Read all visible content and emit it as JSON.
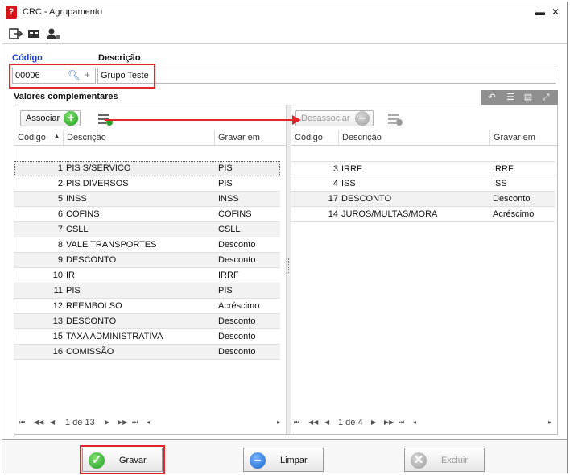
{
  "window": {
    "title": "CRC - Agrupamento",
    "minimize": "▬",
    "close": "✕"
  },
  "form": {
    "codigo_label": "Código",
    "descricao_label": "Descrição",
    "codigo_value": "00006",
    "descricao_value": "Grupo Teste"
  },
  "section": {
    "title": "Valores complementares"
  },
  "left": {
    "associar_label": "Associar",
    "headers": [
      "Código",
      "Descrição",
      "Gravar em"
    ],
    "rows": [
      {
        "codigo": "1",
        "descricao": "PIS S/SERVICO",
        "gravar": "PIS"
      },
      {
        "codigo": "2",
        "descricao": "PIS DIVERSOS",
        "gravar": "PIS"
      },
      {
        "codigo": "5",
        "descricao": "INSS",
        "gravar": "INSS"
      },
      {
        "codigo": "6",
        "descricao": "COFINS",
        "gravar": "COFINS"
      },
      {
        "codigo": "7",
        "descricao": "CSLL",
        "gravar": "CSLL"
      },
      {
        "codigo": "8",
        "descricao": "VALE TRANSPORTES",
        "gravar": "Desconto"
      },
      {
        "codigo": "9",
        "descricao": "DESCONTO",
        "gravar": "Desconto"
      },
      {
        "codigo": "10",
        "descricao": "IR",
        "gravar": "IRRF"
      },
      {
        "codigo": "11",
        "descricao": "PIS",
        "gravar": "PIS"
      },
      {
        "codigo": "12",
        "descricao": "REEMBOLSO",
        "gravar": "Acréscimo"
      },
      {
        "codigo": "13",
        "descricao": "DESCONTO",
        "gravar": "Desconto"
      },
      {
        "codigo": "15",
        "descricao": "TAXA ADMINISTRATIVA",
        "gravar": "Desconto"
      },
      {
        "codigo": "16",
        "descricao": "COMISSÃO",
        "gravar": "Desconto"
      }
    ],
    "pager": "1 de 13"
  },
  "right": {
    "desassociar_label": "Desassociar",
    "headers": [
      "Código",
      "Descrição",
      "Gravar em"
    ],
    "rows": [
      {
        "codigo": "3",
        "descricao": "IRRF",
        "gravar": "IRRF"
      },
      {
        "codigo": "4",
        "descricao": "ISS",
        "gravar": "ISS"
      },
      {
        "codigo": "17",
        "descricao": "DESCONTO",
        "gravar": "Desconto"
      },
      {
        "codigo": "14",
        "descricao": "JUROS/MULTAS/MORA",
        "gravar": "Acréscimo"
      }
    ],
    "pager": "1 de 4"
  },
  "footer": {
    "gravar_label": "Gravar",
    "limpar_label": "Limpar",
    "excluir_label": "Excluir"
  },
  "colors": {
    "highlight": "#e3242b",
    "link_blue": "#1f3fd1"
  }
}
